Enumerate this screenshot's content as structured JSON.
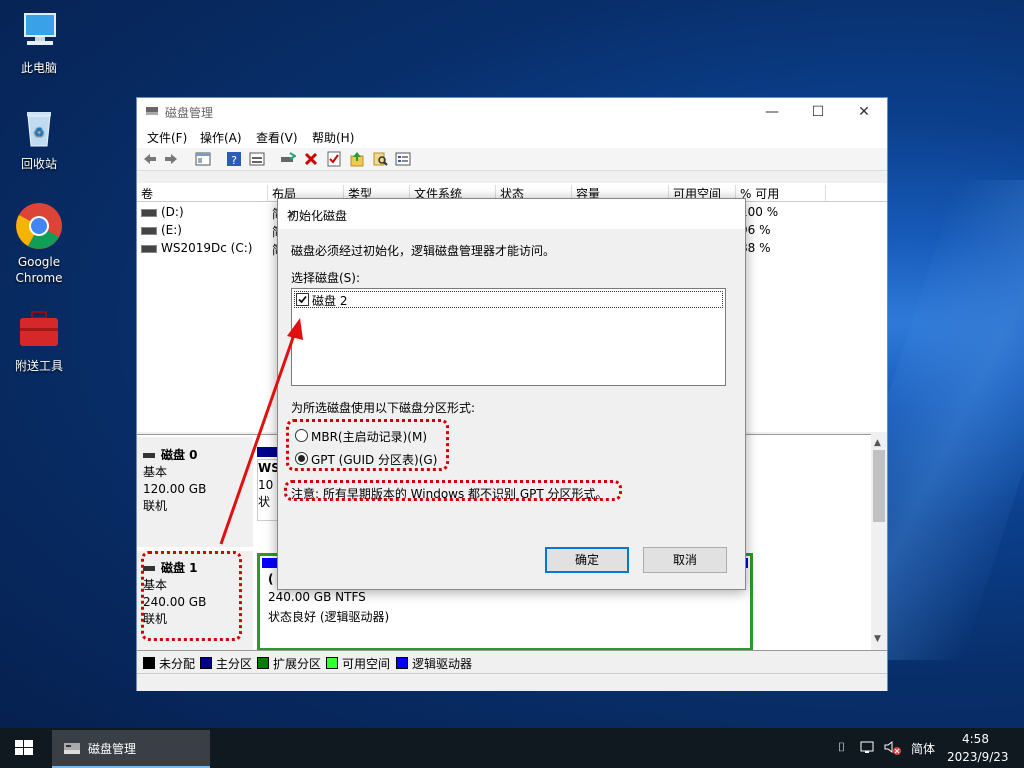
{
  "desktop": {
    "icons": [
      {
        "label": "此电脑",
        "icon": "computer-icon"
      },
      {
        "label": "回收站",
        "icon": "recycle-bin-icon"
      },
      {
        "label": "Google Chrome",
        "line1": "Google",
        "line2": "Chrome",
        "icon": "chrome-icon"
      },
      {
        "label": "附送工具",
        "icon": "toolbox-icon"
      }
    ]
  },
  "window": {
    "title": "磁盘管理",
    "controls": {
      "minimize": "—",
      "maximize": "☐",
      "close": "✕"
    },
    "menu": [
      "文件(F)",
      "操作(A)",
      "查看(V)",
      "帮助(H)"
    ],
    "toolbar": [
      "back-icon",
      "forward-icon",
      "console-tree-icon",
      "help-icon",
      "properties-icon",
      "connect-icon",
      "delete-icon",
      "check-icon",
      "import-icon",
      "search-icon",
      "settings-icon"
    ],
    "volume_columns": [
      "卷",
      "布局",
      "类型",
      "文件系统",
      "状态",
      "容量",
      "可用空间",
      "% 可用"
    ],
    "volumes": [
      {
        "name": "(D:)",
        "layout": "简",
        "pct": "100 %"
      },
      {
        "name": "(E:)",
        "layout": "简",
        "pct": "96 %"
      },
      {
        "name": "WS2019Dc (C:)",
        "layout": "简",
        "pct": "88 %"
      }
    ],
    "disks": [
      {
        "name": "磁盘 0",
        "type": "基本",
        "size": "120.00 GB",
        "status": "联机",
        "partition_label": "WS",
        "partition_size": "10",
        "partition_status": "状"
      },
      {
        "name": "磁盘 1",
        "type": "基本",
        "size": "240.00 GB",
        "status": "联机",
        "partition_label": "(",
        "partition_detail": "240.00 GB NTFS",
        "partition_status": "状态良好 (逻辑驱动器)"
      }
    ],
    "legend": [
      {
        "label": "未分配",
        "color": "#000000"
      },
      {
        "label": "主分区",
        "color": "#00008b"
      },
      {
        "label": "扩展分区",
        "color": "#008000"
      },
      {
        "label": "可用空间",
        "color": "#32ff32"
      },
      {
        "label": "逻辑驱动器",
        "color": "#0000ff"
      }
    ]
  },
  "dialog": {
    "title": "初始化磁盘",
    "close": "✕",
    "intro": "磁盘必须经过初始化，逻辑磁盘管理器才能访问。",
    "select_label": "选择磁盘(S):",
    "disk_item": "磁盘 2",
    "disk_checked": true,
    "style_label": "为所选磁盘使用以下磁盘分区形式:",
    "option_mbr": "MBR(主启动记录)(M)",
    "option_gpt": "GPT (GUID 分区表)(G)",
    "selected": "GPT",
    "note": "注意: 所有早期版本的 Windows 都不识别 GPT 分区形式。",
    "ok": "确定",
    "cancel": "取消"
  },
  "taskbar": {
    "app": "磁盘管理",
    "ime": "简体",
    "time": "4:58",
    "date": "2023/9/23"
  },
  "colors": {
    "annotation": "#d40000",
    "accent": "#0078d7"
  }
}
